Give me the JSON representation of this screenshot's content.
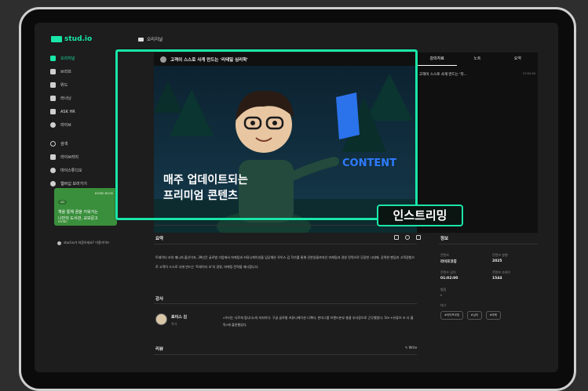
{
  "brand": {
    "name": "stud.io",
    "accent": "#19e6a8"
  },
  "sidebar": {
    "items": [
      {
        "label": "오리지널",
        "icon": "play-icon",
        "active": true
      },
      {
        "label": "브리프",
        "icon": "briefcase-icon"
      },
      {
        "label": "위드",
        "icon": "chat-icon"
      },
      {
        "label": "러너닝",
        "icon": "screen-icon"
      },
      {
        "label": "ASK HR",
        "icon": "hr-icon"
      },
      {
        "label": "라이브",
        "icon": "live-icon"
      }
    ],
    "items2": [
      {
        "label": "검색",
        "icon": "search-icon"
      },
      {
        "label": "라이브러리",
        "icon": "bookmark-icon"
      },
      {
        "label": "마이스튜디오",
        "icon": "gear-icon"
      },
      {
        "label": "웹버십 보러가기",
        "icon": "membership-icon"
      }
    ],
    "banner": {
      "badge": "AD",
      "brand": "KYOBO BOOK",
      "line1": "책을 통해 꿈을 키워가는",
      "line2": "나만의 도서관, 교보문고",
      "footer": "KYOBO"
    },
    "footer": "stud.io가 처음이세요?  이용가이드"
  },
  "topbar": {
    "label": "오리지널"
  },
  "player": {
    "title": "고객이 스스로 사게 만드는 '리테일 심리학'",
    "tabs": [
      "강의자료",
      "노트",
      "요약"
    ],
    "toc_item": "고객이 스스로 사게 만드는 '리...",
    "toc_time": "07:02:00",
    "overlay_line1": "매주 업데이트되는",
    "overlay_line2": "프리미엄 콘텐츠",
    "sign_text": "CONTENT"
  },
  "highlight_badge": "인스트리밍",
  "summary": {
    "title": "요약",
    "text": "트레이더 조의 매니저 출신이자, 39년간 글로벌 기업에서 마케팅과 커뮤니케이션을 담당해온 로이스 김 작가를 통해 진한일들까지인 마케팅과 경영 전략으로 무장한 시대에, 강력한 팬덤과 고객경험으로 고객이 스스로 사게 만드는 '트레이더 조'의 경영, 마케팅 전략을 제시합니다."
  },
  "info": {
    "title": "정보",
    "fields": [
      {
        "label": "콘텐츠",
        "value": "라이프코칭"
      },
      {
        "label": "콘텐츠 발행",
        "value": "2025"
      },
      {
        "label": "콘텐츠 길이",
        "value": "01:02:00"
      },
      {
        "label": "콘텐츠 조회수",
        "value": "1544"
      }
    ],
    "rating_label": "평점",
    "rating_value": "-",
    "tags_label": "태그",
    "tags": [
      "#라이프코칭",
      "#심리",
      "#마케"
    ]
  },
  "instructor": {
    "title": "강사",
    "name": "로이스 김",
    "role": "작가",
    "bio": "«우리는 다르게 팝니다»의 저자이다. 구글 글로벌 커뮤니케이션 디렉터, 한미그룹 브랜드본부 총괄 부사장으로 근무했었다. 5m +유튜브 조 더 블락»에 출연했었다."
  },
  "review": {
    "title": "리뷰",
    "write": "Write"
  }
}
